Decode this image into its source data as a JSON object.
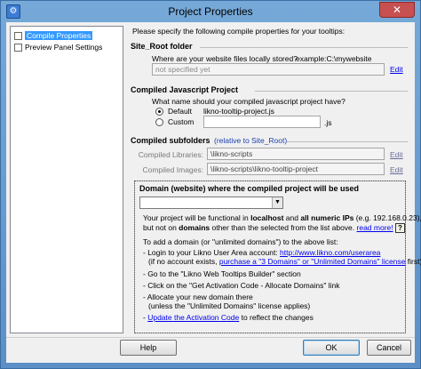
{
  "window": {
    "title": "Project Properties",
    "close_glyph": "✕",
    "app_icon": "app-icon"
  },
  "tree": {
    "items": [
      {
        "label": "Compile Properties",
        "selected": true
      },
      {
        "label": "Preview Panel Settings",
        "selected": false
      }
    ]
  },
  "intro": "Please specify the following compile properties for your tooltips:",
  "site_root": {
    "section_title": "Site_Root folder",
    "question": "Where are your website files locally stored?",
    "example": "example:C:\\mywebsite",
    "value": "not specified yet",
    "edit_label": "Edit"
  },
  "compiled_js": {
    "section_title": "Compiled Javascript Project",
    "question": "What name should your compiled javascript project have?",
    "default_label": "Default",
    "default_value": "likno-tooltip-project.js",
    "custom_label": "Custom",
    "custom_value": "",
    "ext": ".js",
    "selected": "default"
  },
  "subfolders": {
    "section_title": "Compiled subfolders",
    "section_note": "(relative to Site_Root)",
    "libraries_label": "Compiled Libraries:",
    "libraries_value": "\\likno-scripts",
    "images_label": "Compiled Images:",
    "images_value": "\\likno-scripts\\likno-tooltip-project",
    "edit_label": "Edit"
  },
  "domain": {
    "section_title": "Domain (website) where the compiled project will be used",
    "selected_value": "",
    "line1_a": "Your project will be functional in ",
    "line1_b": "localhost",
    "line1_c": " and ",
    "line1_d": "all numeric IPs",
    "line1_e": " (e.g. 192.168.0.23),",
    "line2_a": "but not on ",
    "line2_b": "domains",
    "line2_c": " other than the selected from the list above.",
    "read_more": "read more!",
    "help_glyph": "?",
    "add_intro": "To add a domain (or \"unlimited domains\") to the above list:",
    "step1_a": "- Login to your Likno User Area account: ",
    "step1_link": "http://www.likno.com/userarea",
    "step1b_a": "(if no account exists, ",
    "step1b_link": "purchase a \"3 Domains\" or \"Unlimited Domains\" license",
    "step1b_b": " first)",
    "step2": "- Go to the \"Likno Web Tooltips Builder\" section",
    "step3": "- Click on the \"Get Activation Code - Allocate Domains\" link",
    "step4a": "- Allocate your new domain there",
    "step4b": "(unless the \"Unlimited Domains\" license applies)",
    "step5_a": "- ",
    "step5_link": "Update the Activation Code",
    "step5_b": " to reflect the changes"
  },
  "buttons": {
    "help": "Help",
    "ok": "OK",
    "cancel": "Cancel"
  }
}
